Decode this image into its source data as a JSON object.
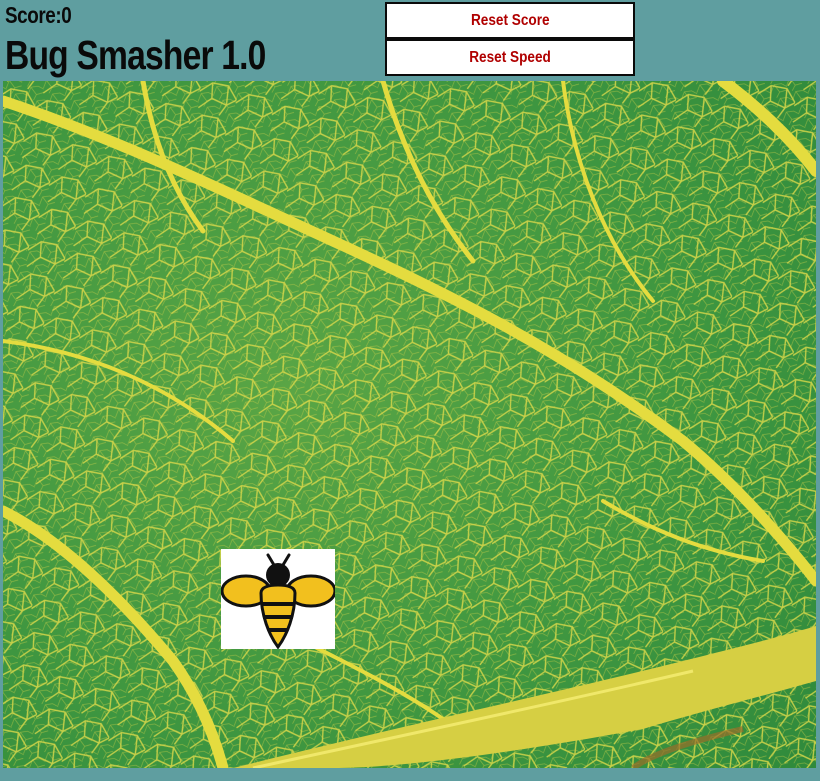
{
  "header": {
    "score_label": "Score:0",
    "title": "Bug Smasher 1.0"
  },
  "controls": {
    "reset_score_label": "Reset Score",
    "reset_speed_label": "Reset Speed"
  },
  "game": {
    "background_icon": "leaf-texture",
    "bug_icon": "bee-icon",
    "colors": {
      "page_background": "#5f9ea0",
      "button_text": "#b00000",
      "leaf_green": "#3f9a3e",
      "vein_yellow": "#e5dc3c",
      "bee_yellow": "#f2c01e"
    }
  }
}
